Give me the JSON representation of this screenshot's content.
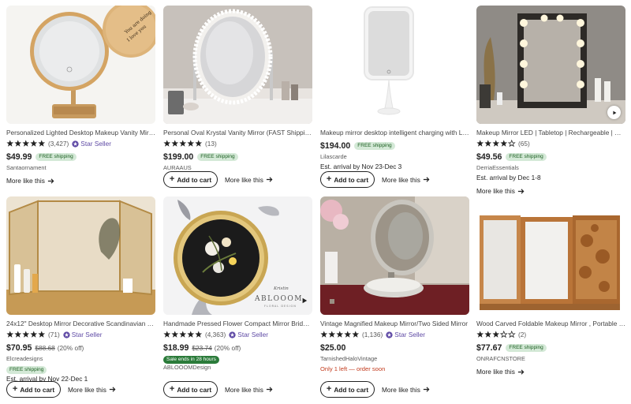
{
  "products": [
    {
      "title": "Personalized Lighted Desktop Makeup Vanity Mirror, Wooden Base",
      "stars": 5,
      "review_count": "(3,427)",
      "star_seller": "Star Seller",
      "price": "$49.99",
      "badge": "FREE shipping",
      "shop": "Santaornament",
      "more_like_this": "More like this",
      "image_engraving": [
        "You are doing",
        "I love you"
      ]
    },
    {
      "title": "Personal Oval Krystal Vanity Mirror (FAST Shipping)",
      "stars": 5,
      "review_count": "(13)",
      "price": "$199.00",
      "badge": "FREE shipping",
      "shop": "AURAAUS",
      "add_to_cart": "Add to cart",
      "more_like_this": "More like this"
    },
    {
      "title": "Makeup mirror desktop intelligent charging with LED light",
      "price": "$194.00",
      "badge": "FREE shipping",
      "shop": "Lilascarde",
      "arrival": "Est. arrival by Nov 23-Dec 3",
      "add_to_cart": "Add to cart",
      "more_like_this": "More like this"
    },
    {
      "title": "Makeup Mirror LED | Tabletop | Rechargeable | Hollywood Mirror",
      "stars": 4,
      "review_count": "(65)",
      "price": "$49.56",
      "badge": "FREE shipping",
      "shop": "DerriaEssentials",
      "arrival": "Est. arrival by Dec 1-8",
      "more_like_this": "More like this"
    },
    {
      "title": "24x12\" Desktop Mirror Decorative Scandinavian Gold Frame Mirror",
      "stars": 5,
      "review_count": "(71)",
      "star_seller": "Star Seller",
      "price": "$70.95",
      "orig_price": "$88.68",
      "discount": "(20% off)",
      "badge": "FREE shipping",
      "shop": "Elcreadesigns",
      "arrival": "Est. arrival by Nov 22-Dec 1",
      "add_to_cart": "Add to cart",
      "more_like_this": "More like this"
    },
    {
      "title": "Handmade Pressed Flower Compact Mirror Bridesmaid Gift",
      "stars": 5,
      "review_count": "(4,363)",
      "star_seller": "Star Seller",
      "price": "$18.99",
      "orig_price": "$23.74",
      "discount": "(20% off)",
      "sale": "Sale ends in 28 hours",
      "shop": "ABLOOOMDesign",
      "add_to_cart": "Add to cart",
      "more_like_this": "More like this",
      "image_brand": "ABLOOOM",
      "image_brand_script": "Kristin",
      "image_brand_sub": "FLORAL DESIGN"
    },
    {
      "title": "Vintage Magnified Makeup Mirror/Two Sided Mirror",
      "stars": 5,
      "review_count": "(1,136)",
      "star_seller": "Star Seller",
      "price": "$25.00",
      "shop": "TarnishedHaloVintage",
      "warning": "Only 1 left — order soon",
      "add_to_cart": "Add to cart",
      "more_like_this": "More like this"
    },
    {
      "title": "Wood Carved Foldable Makeup Mirror , Portable Mirror",
      "stars": 3,
      "review_count": "(2)",
      "price": "$77.67",
      "badge": "FREE shipping",
      "shop": "ONRAFCNSTORE",
      "more_like_this": "More like this"
    }
  ],
  "colors": {
    "star": "#222222",
    "star_seller": "#5f4aa5",
    "free_shipping_bg": "#d4e9d7",
    "sale_bg": "#2b7b3a",
    "warning": "#c23a1c"
  }
}
